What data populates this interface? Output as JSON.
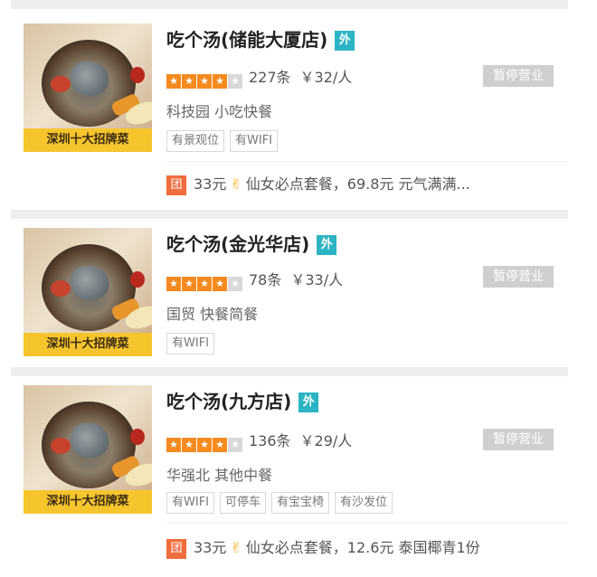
{
  "stores": [
    {
      "thumb_banner": "深圳十大招牌菜",
      "name": "吃个汤(储能大厦店)",
      "takeout_badge": "外",
      "star_rating": 4,
      "review_count": "227条",
      "avg_price": "￥32/人",
      "status": "暂停营业",
      "category": "科技园 小吃快餐",
      "features": [
        "有景观位",
        "有WIFI"
      ],
      "deal": {
        "icon": "团",
        "price": "33元",
        "text": "仙女必点套餐，69.8元 元气满满..."
      }
    },
    {
      "thumb_banner": "深圳十大招牌菜",
      "name": "吃个汤(金光华店)",
      "takeout_badge": "外",
      "star_rating": 4,
      "review_count": "78条",
      "avg_price": "￥33/人",
      "status": "暂停营业",
      "category": "国贸 快餐简餐",
      "features": [
        "有WIFI"
      ]
    },
    {
      "thumb_banner": "深圳十大招牌菜",
      "name": "吃个汤(九方店)",
      "takeout_badge": "外",
      "star_rating": 4,
      "review_count": "136条",
      "avg_price": "￥29/人",
      "status": "暂停营业",
      "category": "华强北 其他中餐",
      "features": [
        "有WIFI",
        "可停车",
        "有宝宝椅",
        "有沙发位"
      ],
      "deal": {
        "icon": "团",
        "price": "33元",
        "text": "仙女必点套餐，12.6元 泰国椰青1份"
      }
    }
  ],
  "colors": {
    "accent_orange": "#f58a1f",
    "takeout_teal": "#2db4c4",
    "tuan_red": "#f06d3d",
    "banner_yellow": "#f6c52e"
  }
}
